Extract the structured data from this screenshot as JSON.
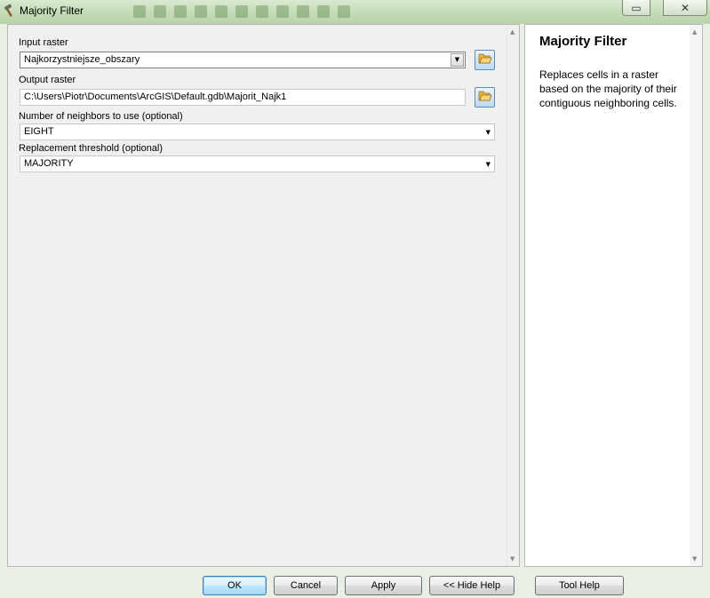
{
  "window": {
    "title": "Majority Filter",
    "close_glyph": "✕",
    "restore_glyph": "▭"
  },
  "params": {
    "input_raster": {
      "label": "Input raster",
      "value": "Najkorzystniejsze_obszary"
    },
    "output_raster": {
      "label": "Output raster",
      "value": "C:\\Users\\Piotr\\Documents\\ArcGIS\\Default.gdb\\Majorit_Najk1"
    },
    "neighbors": {
      "label": "Number of neighbors to use (optional)",
      "value": "EIGHT"
    },
    "threshold": {
      "label": "Replacement threshold (optional)",
      "value": "MAJORITY"
    }
  },
  "help": {
    "title": "Majority Filter",
    "body": "Replaces cells in a raster based on the majority of their contiguous neighboring cells."
  },
  "buttons": {
    "ok": "OK",
    "cancel": "Cancel",
    "apply": "Apply",
    "hide_help": "<< Hide Help",
    "tool_help": "Tool Help"
  },
  "icons": {
    "app": "hammer-icon",
    "browse": "folder-open-icon",
    "dropdown": "chevron-down-icon"
  },
  "colors": {
    "titlebar": "#c4dcb8",
    "pane_bg": "#f0f0f0",
    "default_button": "#bee6fd"
  }
}
